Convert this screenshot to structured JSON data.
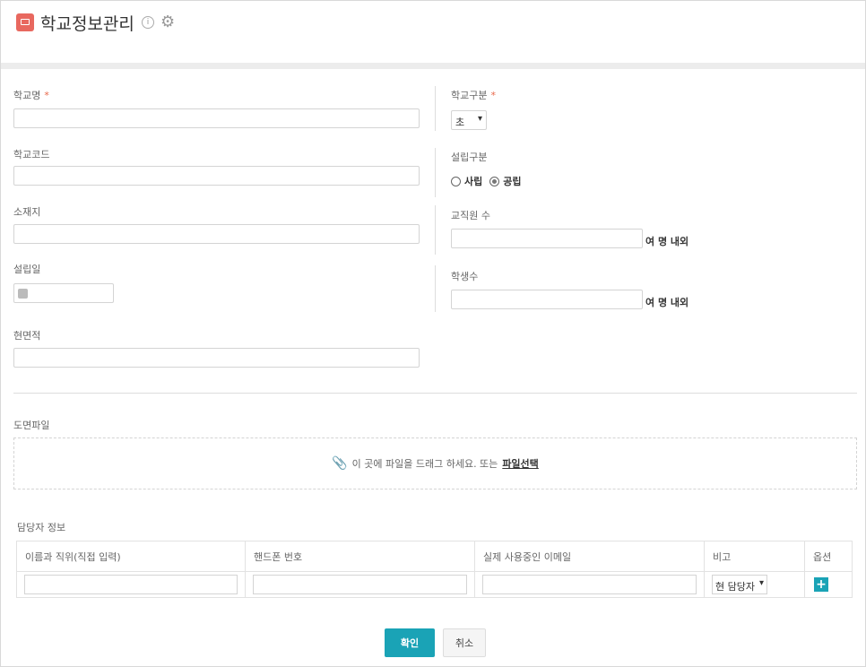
{
  "header": {
    "title": "학교정보관리",
    "app_icon": "laptop-icon",
    "info_icon": "info-icon",
    "settings_icon": "gear-icon"
  },
  "form": {
    "school_name": {
      "label": "학교명",
      "required": "*",
      "value": ""
    },
    "school_code": {
      "label": "학교코드",
      "value": ""
    },
    "address": {
      "label": "소재지",
      "value": ""
    },
    "founded_date": {
      "label": "설립일",
      "value": ""
    },
    "area": {
      "label": "현면적",
      "value": ""
    },
    "school_type": {
      "label": "학교구분",
      "required": "*",
      "selected": "초"
    },
    "founding_type": {
      "label": "설립구분",
      "options": [
        "사립",
        "공립"
      ],
      "selected": "공립"
    },
    "staff_count": {
      "label": "교직원 수",
      "value": "",
      "unit": "여 명 내외"
    },
    "student_count": {
      "label": "학생수",
      "value": "",
      "unit": "여 명 내외"
    }
  },
  "file": {
    "label": "도면파일",
    "drop_text": "이 곳에 파일을 드래그 하세요. 또는",
    "select_link": "파일선택"
  },
  "contacts": {
    "title": "담당자 정보",
    "columns": [
      "이름과 직위(직접 입력)",
      "핸드폰 번호",
      "실제 사용중인 이메일",
      "비고",
      "옵션"
    ],
    "row": {
      "name": "",
      "phone": "",
      "email": "",
      "note_selected": "현 담당자"
    }
  },
  "buttons": {
    "confirm": "확인",
    "cancel": "취소"
  },
  "colors": {
    "accent": "#1aa3b6",
    "brand_icon": "#e8685f"
  }
}
